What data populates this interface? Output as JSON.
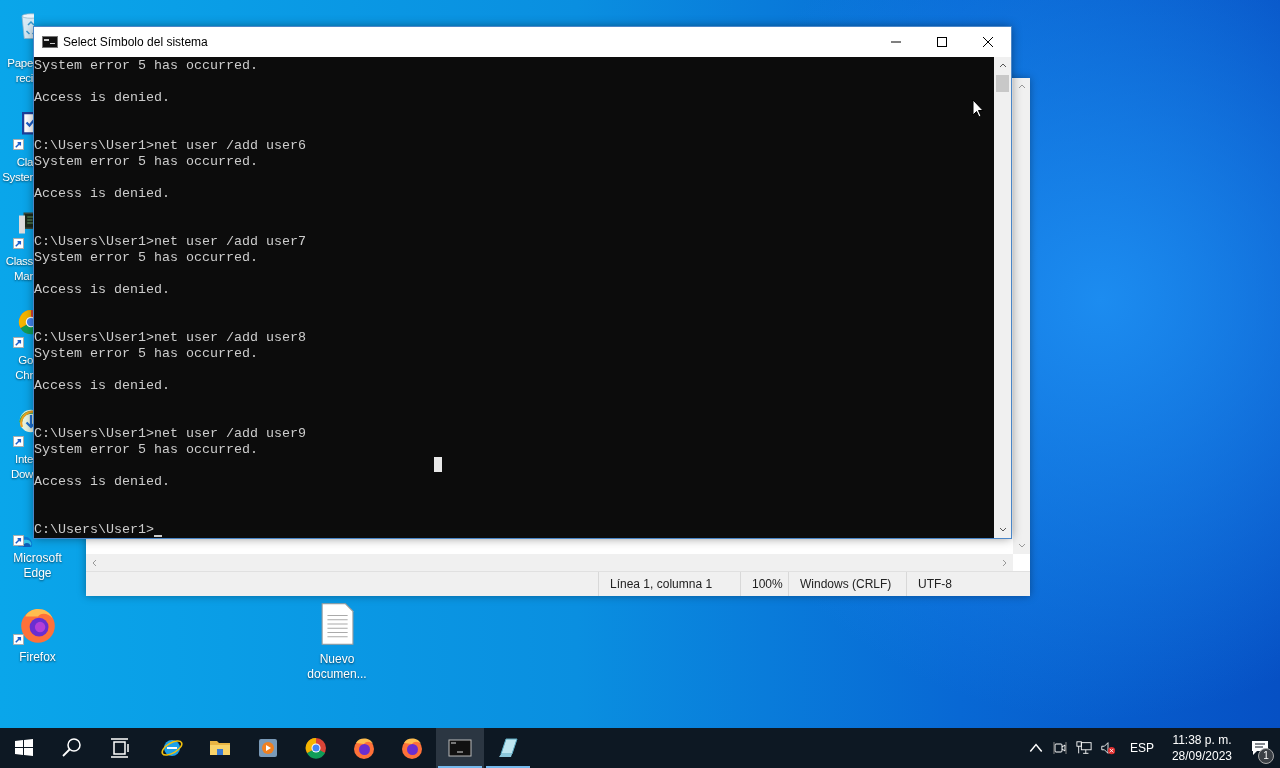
{
  "desktop_icons": [
    {
      "kind": "partial",
      "label_lines": [
        "Pape",
        "reci"
      ],
      "shortcut": false
    },
    {
      "kind": "partial",
      "label_lines": [
        "Cla",
        "Syster"
      ],
      "shortcut": true
    },
    {
      "kind": "partial",
      "label_lines": [
        "Class",
        "Mar"
      ],
      "shortcut": true
    },
    {
      "kind": "partial",
      "label_lines": [
        "Go",
        "Chr"
      ],
      "shortcut": true
    },
    {
      "kind": "partial",
      "label_lines": [
        "Inte",
        "Dow"
      ],
      "shortcut": true
    },
    {
      "kind": "under",
      "label_lines": [
        "Microsoft",
        "Edge"
      ],
      "shortcut": true
    },
    {
      "kind": "whole",
      "label_lines": [
        "Firefox"
      ],
      "shortcut": true
    }
  ],
  "desktop_file": {
    "label_lines": [
      "Nuevo",
      "documen..."
    ]
  },
  "notepad": {
    "status_bar": [
      "Línea 1, columna 1",
      "100%",
      "Windows (CRLF)",
      "UTF-8"
    ]
  },
  "console": {
    "title": "Select Símbolo del sistema",
    "lines": [
      {
        "kind": "output",
        "text": "System error 5 has occurred."
      },
      {
        "kind": "blank"
      },
      {
        "kind": "output",
        "text": "Access is denied."
      },
      {
        "kind": "blank"
      },
      {
        "kind": "blank"
      },
      {
        "kind": "output",
        "text": "C:\\Users\\User1>net user /add user6"
      },
      {
        "kind": "output",
        "text": "System error 5 has occurred."
      },
      {
        "kind": "blank"
      },
      {
        "kind": "output",
        "text": "Access is denied."
      },
      {
        "kind": "blank"
      },
      {
        "kind": "blank"
      },
      {
        "kind": "output",
        "text": "C:\\Users\\User1>net user /add user7"
      },
      {
        "kind": "output",
        "text": "System error 5 has occurred."
      },
      {
        "kind": "blank"
      },
      {
        "kind": "output",
        "text": "Access is denied."
      },
      {
        "kind": "blank"
      },
      {
        "kind": "blank"
      },
      {
        "kind": "output",
        "text": "C:\\Users\\User1>net user /add user8"
      },
      {
        "kind": "output",
        "text": "System error 5 has occurred."
      },
      {
        "kind": "blank"
      },
      {
        "kind": "output",
        "text": "Access is denied."
      },
      {
        "kind": "blank"
      },
      {
        "kind": "blank"
      },
      {
        "kind": "output",
        "text": "C:\\Users\\User1>net user /add user9"
      },
      {
        "kind": "output",
        "text": "System error 5 has occurred."
      },
      {
        "kind": "blank"
      },
      {
        "kind": "output",
        "text": "Access is denied."
      },
      {
        "kind": "blank"
      },
      {
        "kind": "blank"
      },
      {
        "kind": "prompt",
        "text": "C:\\Users\\User1>"
      }
    ]
  },
  "taskbar": {
    "apps": [
      {
        "selected": false,
        "running": false
      },
      {
        "selected": false,
        "running": false
      },
      {
        "selected": false,
        "running": false
      },
      {
        "selected": false,
        "running": false
      },
      {
        "selected": false,
        "running": false
      },
      {
        "selected": false,
        "running": false
      },
      {
        "selected": true,
        "running": true
      },
      {
        "selected": false,
        "running": true
      }
    ],
    "tray": {
      "language": "ESP",
      "time": "11:38 p. m.",
      "date": "28/09/2023",
      "notifications": "1"
    }
  }
}
